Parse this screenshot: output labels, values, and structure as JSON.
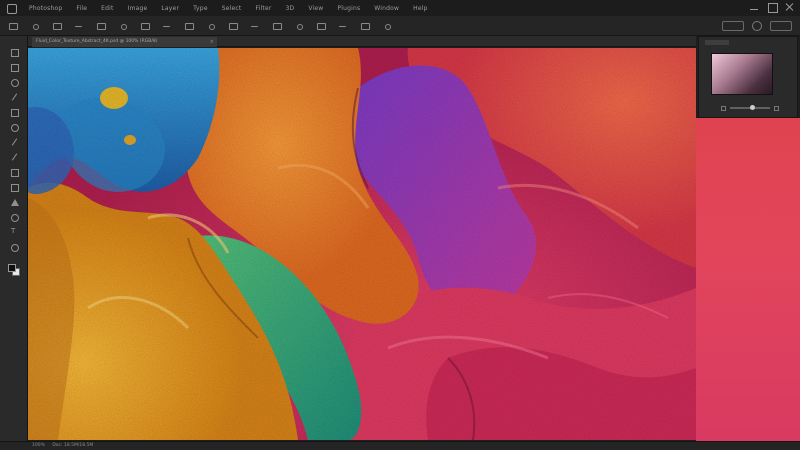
{
  "menubar": {
    "items": [
      "Photoshop",
      "File",
      "Edit",
      "Image",
      "Layer",
      "Type",
      "Select",
      "Filter",
      "3D",
      "View",
      "Plugins",
      "Window",
      "Help"
    ]
  },
  "tab": {
    "label": "Fluid_Color_Texture_Abstract_4K.psd @ 100% (RGB/8)",
    "close": "×"
  },
  "statusbar": {
    "zoom": "100%",
    "doc": "Doc: 18.5M/18.5M"
  },
  "colors": {
    "menubar_bg": "#1c1c1c",
    "panel_bg": "#2a2a2a",
    "canvas_accent": "#cc3a5a"
  },
  "icons": [
    "photoshop-icon",
    "move-tool-icon",
    "marquee-tool-icon",
    "lasso-tool-icon",
    "crop-tool-icon",
    "brush-tool-icon",
    "eraser-tool-icon",
    "type-tool-icon",
    "zoom-tool-icon"
  ]
}
